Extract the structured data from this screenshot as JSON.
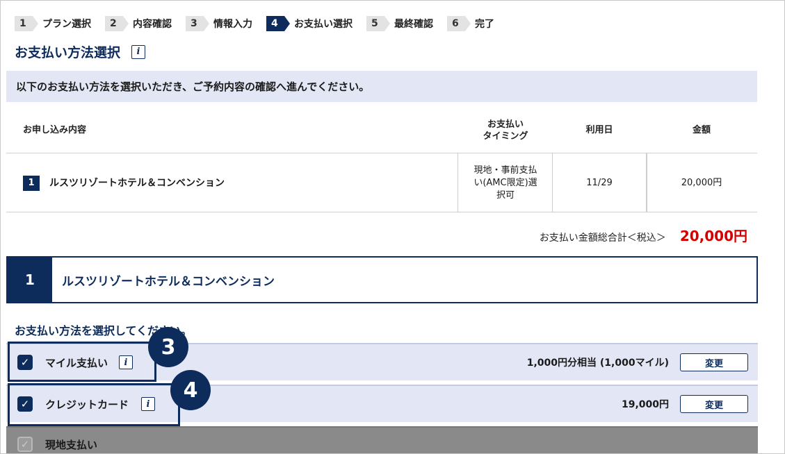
{
  "steps": [
    {
      "num": "1",
      "label": "プラン選択"
    },
    {
      "num": "2",
      "label": "内容確認"
    },
    {
      "num": "3",
      "label": "情報入力"
    },
    {
      "num": "4",
      "label": "お支払い選択"
    },
    {
      "num": "5",
      "label": "最終確認"
    },
    {
      "num": "6",
      "label": "完了"
    }
  ],
  "page_title": "お支払い方法選択",
  "info_icon_glyph": "i",
  "notice": "以下のお支払い方法を選択いただき、ご予約内容の確認へ進んでください。",
  "table": {
    "headers": {
      "content": "お申し込み内容",
      "timing_line1": "お支払い",
      "timing_line2": "タイミング",
      "date": "利用日",
      "amount": "金額"
    },
    "rows": [
      {
        "num": "1",
        "name": "ルスツリゾートホテル＆コンベンション",
        "timing_line1": "現地・事前支払",
        "timing_line2": "い(AMC限定)選",
        "timing_line3": "択可",
        "date": "11/29",
        "amount": "20,000円"
      }
    ]
  },
  "total": {
    "label": "お支払い金額総合計＜税込＞",
    "amount": "20,000円"
  },
  "hotel": {
    "num": "1",
    "name": "ルスツリゾートホテル＆コンベンション"
  },
  "choose_label": "お支払い方法を選択してください。",
  "payments": [
    {
      "label": "マイル支払い",
      "amount": "1,000円分相当 (1,000マイル)",
      "button": "変更",
      "checked": true
    },
    {
      "label": "クレジットカード",
      "amount": "19,000円",
      "button": "変更",
      "checked": true
    },
    {
      "label": "現地支払い",
      "checked": false
    }
  ],
  "callouts": [
    "3",
    "4"
  ],
  "colors": {
    "navy": "#0d2c5c",
    "total_red": "#d60000",
    "row_bg": "#e3e7f5"
  }
}
